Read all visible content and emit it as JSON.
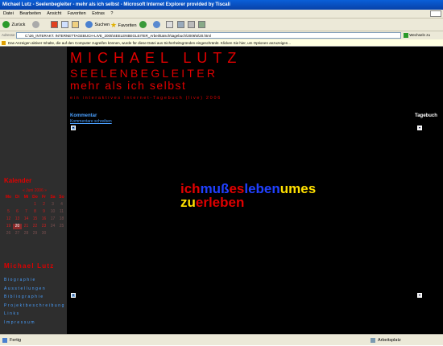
{
  "window": {
    "title": "Michael Lutz - Seelenbegleiter - mehr als ich selbst - Microsoft Internet Explorer provided by Tiscali"
  },
  "menu": [
    "Datei",
    "Bearbeiten",
    "Ansicht",
    "Favoriten",
    "Extras",
    "?"
  ],
  "toolbar": {
    "back": "Zurück",
    "search": "Suchen",
    "favorites": "Favoriten"
  },
  "address": {
    "label": "Adresse",
    "url": "C:\\26_INTERAKT. INTERNETTAGEBUCH-LIVE_2005\\SEELENBEGLEITER_Arbeit\\tatsch\\tagebuch\\2006\\6\\20.html",
    "go_label": "Wechseln zu"
  },
  "infobar": {
    "text": "Das Anzeigen aktiver Inhalte, die auf den Computer zugreifen können, wurde für diese Datei aus Sicherheitsgründen eingeschränkt. Klicken Sie hier, um Optionen anzuzeigen..."
  },
  "header": {
    "name": "MICHAEL LUTZ",
    "title": "SEELENBEGLEITER",
    "subtitle": "mehr als ich selbst",
    "tagline": "ein interaktives Internet-Tagebuch (live) 2006"
  },
  "kommentar": {
    "heading": "Kommentar",
    "link": "Kommentare schreiben"
  },
  "tagebuch": {
    "heading": "Tagebuch"
  },
  "calendar": {
    "heading": "Kalender",
    "month": "« Juni 2006 »",
    "weekdays": [
      "Mo",
      "Di",
      "Mi",
      "Do",
      "Fr",
      "Sa",
      "So"
    ],
    "days": [
      "",
      "",
      "",
      "1",
      "2",
      "3",
      "4",
      "5",
      "6",
      "7",
      "8",
      "9",
      "10",
      "11",
      "12",
      "13",
      "14",
      "15",
      "16",
      "17",
      "18",
      "19",
      "20",
      "21",
      "22",
      "23",
      "24",
      "25",
      "26",
      "27",
      "28",
      "29",
      "30",
      "",
      ""
    ],
    "today": "20"
  },
  "sidebar_nav": {
    "heading": "Michael Lutz",
    "items": [
      "Biographie",
      "Ausstellungen",
      "Bibliographie",
      "Projektbeschreibung",
      "Links",
      "Impressum"
    ]
  },
  "center": {
    "line1": [
      {
        "text": "ich",
        "color": "#e00000"
      },
      {
        "text": "muß",
        "color": "#2040ff"
      },
      {
        "text": "es",
        "color": "#e00000"
      },
      {
        "text": "leben",
        "color": "#2040ff"
      },
      {
        "text": "umes",
        "color": "#ffe000"
      }
    ],
    "line2": [
      {
        "text": "zu",
        "color": "#ffe000"
      },
      {
        "text": "erleben",
        "color": "#e00000"
      }
    ]
  },
  "status": {
    "left": "Fertig",
    "right": "Arbeitsplatz"
  },
  "colors": {
    "accent_red": "#e00000",
    "link_blue": "#4aa0ff",
    "bg": "#000000",
    "sidebar": "#2e2e2e"
  }
}
